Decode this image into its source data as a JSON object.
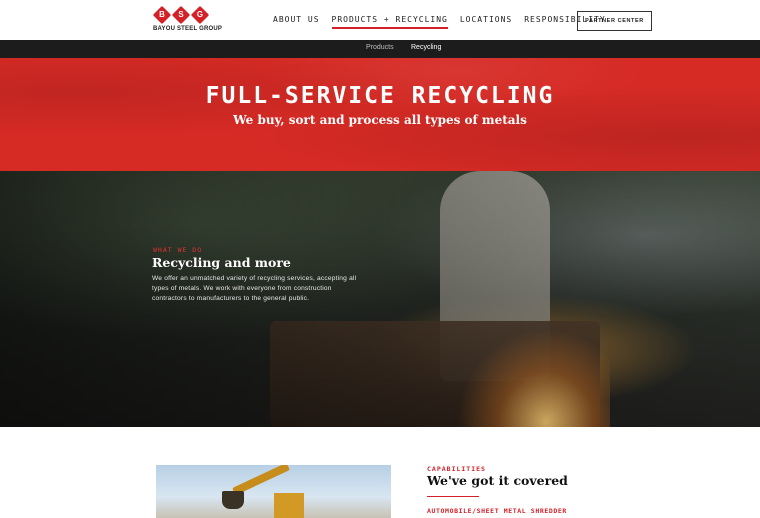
{
  "header": {
    "logo_letters": [
      "B",
      "S",
      "G"
    ],
    "logo_text": "BAYOU STEEL GROUP",
    "nav": [
      {
        "label": "ABOUT US",
        "active": false
      },
      {
        "label": "PRODUCTS + RECYCLING",
        "active": true
      },
      {
        "label": "LOCATIONS",
        "active": false
      },
      {
        "label": "RESPONSIBILITY",
        "active": false
      }
    ],
    "partner_center": "PARTNER CENTER"
  },
  "subnav": {
    "products": "Products",
    "recycling": "Recycling"
  },
  "hero": {
    "title": "FULL-SERVICE RECYCLING",
    "subtitle": "We buy, sort and process all types of metals"
  },
  "what_we_do": {
    "label": "WHAT WE DO",
    "title": "Recycling and more",
    "body": "We offer an unmatched variety of recycling services, accepting all types of metals. We work with everyone from construction contractors to manufacturers to the general public."
  },
  "capabilities": {
    "label": "CAPABILITIES",
    "title": "We've got it covered",
    "first_item": "AUTOMOBILE/SHEET METAL SHREDDER"
  },
  "colors": {
    "brand_red": "#d42027",
    "subnav_bg": "#1c1c1c"
  }
}
